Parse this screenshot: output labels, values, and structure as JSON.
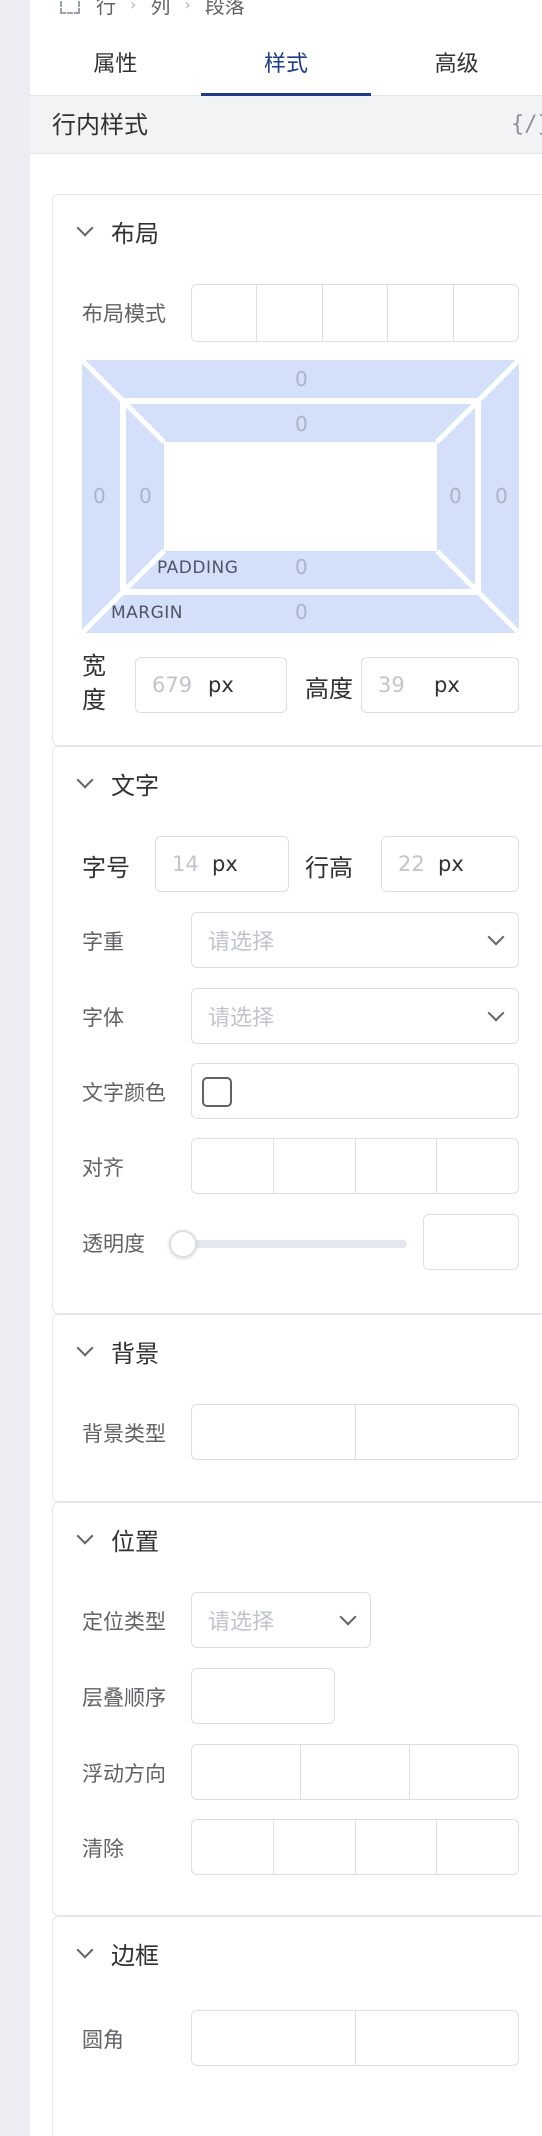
{
  "breadcrumb": {
    "items": [
      "行",
      "列",
      "段落"
    ]
  },
  "tabs": [
    "属性",
    "样式",
    "高级"
  ],
  "section": {
    "title": "行内样式",
    "code_icon": "{/}"
  },
  "layout": {
    "title": "布局",
    "mode_label": "布局模式",
    "box_model": {
      "margin_label": "MARGIN",
      "padding_label": "PADDING",
      "margin": {
        "top": "0",
        "right": "0",
        "bottom": "0",
        "left": "0"
      },
      "padding": {
        "top": "0",
        "right": "0",
        "bottom": "0",
        "left": "0"
      }
    },
    "width_label": "宽度",
    "width_value": "679",
    "height_label": "高度",
    "height_value": "39",
    "unit": "px"
  },
  "text": {
    "title": "文字",
    "font_size_label": "字号",
    "font_size_value": "14",
    "line_height_label": "行高",
    "line_height_value": "22",
    "unit": "px",
    "weight_label": "字重",
    "family_label": "字体",
    "placeholder": "请选择",
    "color_label": "文字颜色",
    "align_label": "对齐",
    "opacity_label": "透明度",
    "opacity_value": 0
  },
  "background": {
    "title": "背景",
    "type_label": "背景类型"
  },
  "position": {
    "title": "位置",
    "type_label": "定位类型",
    "placeholder": "请选择",
    "zindex_label": "层叠顺序",
    "float_label": "浮动方向",
    "clear_label": "清除"
  },
  "border": {
    "title": "边框",
    "radius_label": "圆角"
  },
  "colors": {
    "accent": "#1f3c88",
    "box_model_fill": "#d4e0fa",
    "border": "#dcdfe6"
  }
}
